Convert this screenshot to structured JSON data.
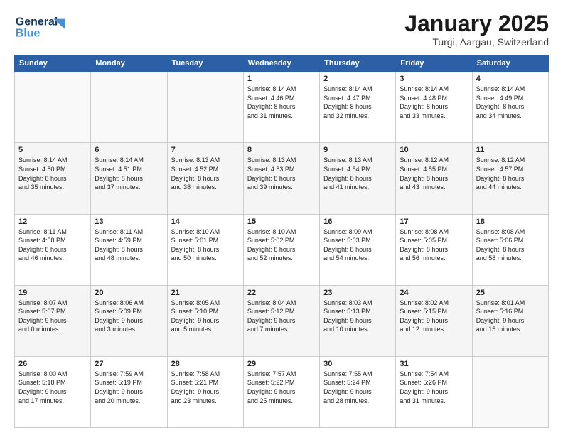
{
  "header": {
    "logo_line1": "General",
    "logo_line2": "Blue",
    "month_title": "January 2025",
    "location": "Turgi, Aargau, Switzerland"
  },
  "weekdays": [
    "Sunday",
    "Monday",
    "Tuesday",
    "Wednesday",
    "Thursday",
    "Friday",
    "Saturday"
  ],
  "weeks": [
    [
      {
        "day": "",
        "info": ""
      },
      {
        "day": "",
        "info": ""
      },
      {
        "day": "",
        "info": ""
      },
      {
        "day": "1",
        "info": "Sunrise: 8:14 AM\nSunset: 4:46 PM\nDaylight: 8 hours\nand 31 minutes."
      },
      {
        "day": "2",
        "info": "Sunrise: 8:14 AM\nSunset: 4:47 PM\nDaylight: 8 hours\nand 32 minutes."
      },
      {
        "day": "3",
        "info": "Sunrise: 8:14 AM\nSunset: 4:48 PM\nDaylight: 8 hours\nand 33 minutes."
      },
      {
        "day": "4",
        "info": "Sunrise: 8:14 AM\nSunset: 4:49 PM\nDaylight: 8 hours\nand 34 minutes."
      }
    ],
    [
      {
        "day": "5",
        "info": "Sunrise: 8:14 AM\nSunset: 4:50 PM\nDaylight: 8 hours\nand 35 minutes."
      },
      {
        "day": "6",
        "info": "Sunrise: 8:14 AM\nSunset: 4:51 PM\nDaylight: 8 hours\nand 37 minutes."
      },
      {
        "day": "7",
        "info": "Sunrise: 8:13 AM\nSunset: 4:52 PM\nDaylight: 8 hours\nand 38 minutes."
      },
      {
        "day": "8",
        "info": "Sunrise: 8:13 AM\nSunset: 4:53 PM\nDaylight: 8 hours\nand 39 minutes."
      },
      {
        "day": "9",
        "info": "Sunrise: 8:13 AM\nSunset: 4:54 PM\nDaylight: 8 hours\nand 41 minutes."
      },
      {
        "day": "10",
        "info": "Sunrise: 8:12 AM\nSunset: 4:55 PM\nDaylight: 8 hours\nand 43 minutes."
      },
      {
        "day": "11",
        "info": "Sunrise: 8:12 AM\nSunset: 4:57 PM\nDaylight: 8 hours\nand 44 minutes."
      }
    ],
    [
      {
        "day": "12",
        "info": "Sunrise: 8:11 AM\nSunset: 4:58 PM\nDaylight: 8 hours\nand 46 minutes."
      },
      {
        "day": "13",
        "info": "Sunrise: 8:11 AM\nSunset: 4:59 PM\nDaylight: 8 hours\nand 48 minutes."
      },
      {
        "day": "14",
        "info": "Sunrise: 8:10 AM\nSunset: 5:01 PM\nDaylight: 8 hours\nand 50 minutes."
      },
      {
        "day": "15",
        "info": "Sunrise: 8:10 AM\nSunset: 5:02 PM\nDaylight: 8 hours\nand 52 minutes."
      },
      {
        "day": "16",
        "info": "Sunrise: 8:09 AM\nSunset: 5:03 PM\nDaylight: 8 hours\nand 54 minutes."
      },
      {
        "day": "17",
        "info": "Sunrise: 8:08 AM\nSunset: 5:05 PM\nDaylight: 8 hours\nand 56 minutes."
      },
      {
        "day": "18",
        "info": "Sunrise: 8:08 AM\nSunset: 5:06 PM\nDaylight: 8 hours\nand 58 minutes."
      }
    ],
    [
      {
        "day": "19",
        "info": "Sunrise: 8:07 AM\nSunset: 5:07 PM\nDaylight: 9 hours\nand 0 minutes."
      },
      {
        "day": "20",
        "info": "Sunrise: 8:06 AM\nSunset: 5:09 PM\nDaylight: 9 hours\nand 3 minutes."
      },
      {
        "day": "21",
        "info": "Sunrise: 8:05 AM\nSunset: 5:10 PM\nDaylight: 9 hours\nand 5 minutes."
      },
      {
        "day": "22",
        "info": "Sunrise: 8:04 AM\nSunset: 5:12 PM\nDaylight: 9 hours\nand 7 minutes."
      },
      {
        "day": "23",
        "info": "Sunrise: 8:03 AM\nSunset: 5:13 PM\nDaylight: 9 hours\nand 10 minutes."
      },
      {
        "day": "24",
        "info": "Sunrise: 8:02 AM\nSunset: 5:15 PM\nDaylight: 9 hours\nand 12 minutes."
      },
      {
        "day": "25",
        "info": "Sunrise: 8:01 AM\nSunset: 5:16 PM\nDaylight: 9 hours\nand 15 minutes."
      }
    ],
    [
      {
        "day": "26",
        "info": "Sunrise: 8:00 AM\nSunset: 5:18 PM\nDaylight: 9 hours\nand 17 minutes."
      },
      {
        "day": "27",
        "info": "Sunrise: 7:59 AM\nSunset: 5:19 PM\nDaylight: 9 hours\nand 20 minutes."
      },
      {
        "day": "28",
        "info": "Sunrise: 7:58 AM\nSunset: 5:21 PM\nDaylight: 9 hours\nand 23 minutes."
      },
      {
        "day": "29",
        "info": "Sunrise: 7:57 AM\nSunset: 5:22 PM\nDaylight: 9 hours\nand 25 minutes."
      },
      {
        "day": "30",
        "info": "Sunrise: 7:55 AM\nSunset: 5:24 PM\nDaylight: 9 hours\nand 28 minutes."
      },
      {
        "day": "31",
        "info": "Sunrise: 7:54 AM\nSunset: 5:26 PM\nDaylight: 9 hours\nand 31 minutes."
      },
      {
        "day": "",
        "info": ""
      }
    ]
  ]
}
